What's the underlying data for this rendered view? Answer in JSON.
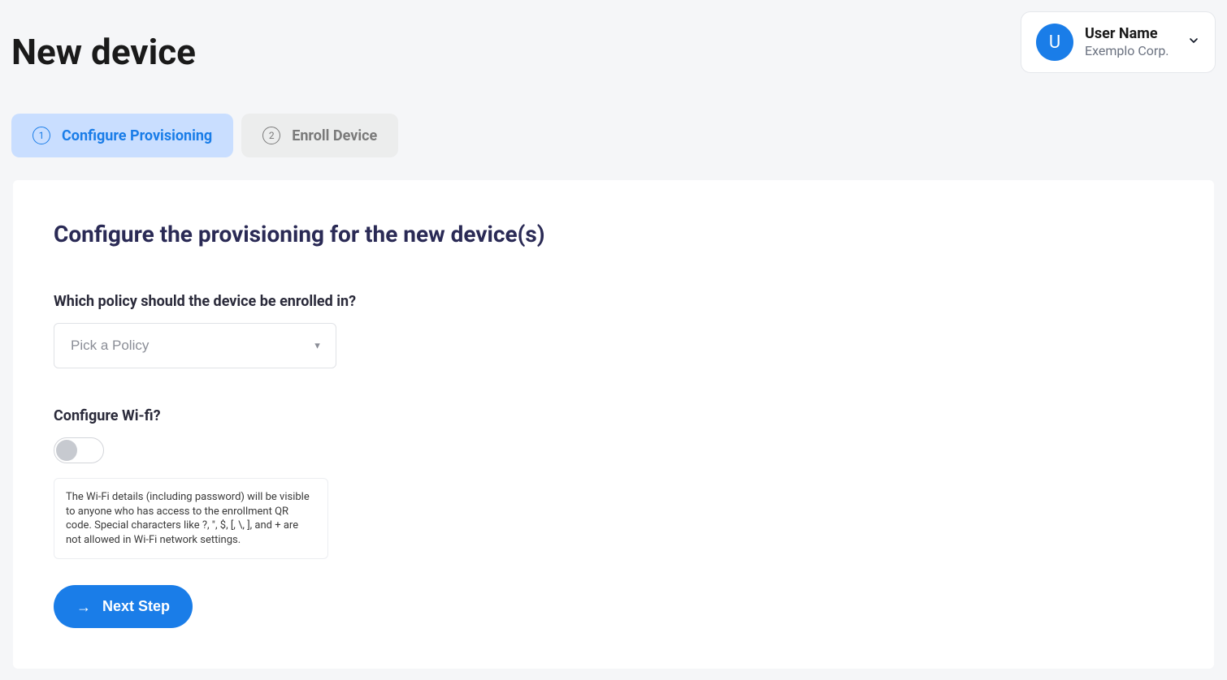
{
  "header": {
    "title": "New device",
    "user": {
      "initial": "U",
      "name": "User Name",
      "org": "Exemplo Corp."
    }
  },
  "steps": [
    {
      "number": "1",
      "label": "Configure Provisioning",
      "active": true
    },
    {
      "number": "2",
      "label": "Enroll Device",
      "active": false
    }
  ],
  "form": {
    "section_title": "Configure the provisioning for the new device(s)",
    "policy": {
      "label": "Which policy should the device be enrolled in?",
      "placeholder": "Pick a Policy"
    },
    "wifi": {
      "label": "Configure Wi-fi?",
      "info": "The Wi-Fi details (including password) will be visible to anyone who has access to the enrollment QR code. Special characters like ?, \", $, [, \\, ], and + are not allowed in Wi-Fi network settings."
    },
    "next_label": "Next Step"
  }
}
